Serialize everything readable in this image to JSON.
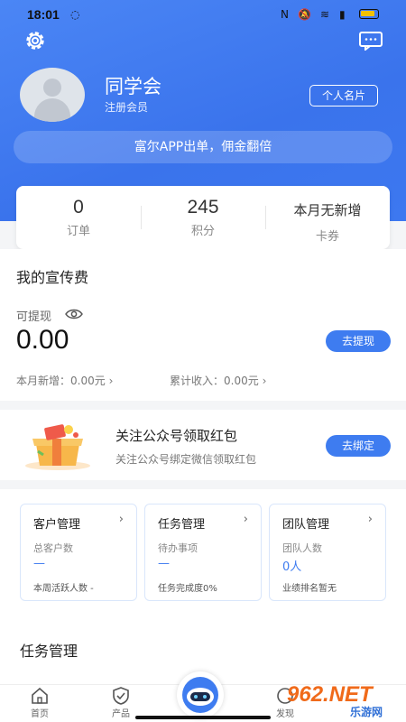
{
  "status_bar": {
    "time": "18:01"
  },
  "header": {
    "username": "同学会",
    "role": "注册会员",
    "card_button": "个人名片",
    "promo_banner": "富尔APP出单，佣金翻倍"
  },
  "stats": [
    {
      "value": "0",
      "label": "订单"
    },
    {
      "value": "245",
      "label": "积分"
    },
    {
      "value": "本月无新增",
      "label": "卡券"
    }
  ],
  "earnings": {
    "title": "我的宣传费",
    "withdrawable_label": "可提现",
    "amount": "0.00",
    "withdraw_button": "去提现",
    "month_new": "本月新增：0.00元",
    "total_income": "累计收入：0.00元"
  },
  "follow": {
    "title": "关注公众号领取红包",
    "subtitle": "关注公众号绑定微信领取红包",
    "bind_button": "去绑定"
  },
  "management_cards": [
    {
      "title": "客户管理",
      "sub": "总客户数",
      "value": "—",
      "foot": "本周活跃人数 -"
    },
    {
      "title": "任务管理",
      "sub": "待办事项",
      "value": "—",
      "foot": "任务完成度0%"
    },
    {
      "title": "团队管理",
      "sub": "团队人数",
      "value": "0人",
      "foot": "业绩排名暂无"
    }
  ],
  "task_section": {
    "title": "任务管理"
  },
  "tabbar": {
    "home": "首页",
    "product": "产品",
    "discover": "发现"
  },
  "watermark": {
    "brand": "962.NET",
    "sub": "乐游网"
  },
  "colors": {
    "primary": "#3e7cf0",
    "header_gradient": "#4b86f5"
  }
}
